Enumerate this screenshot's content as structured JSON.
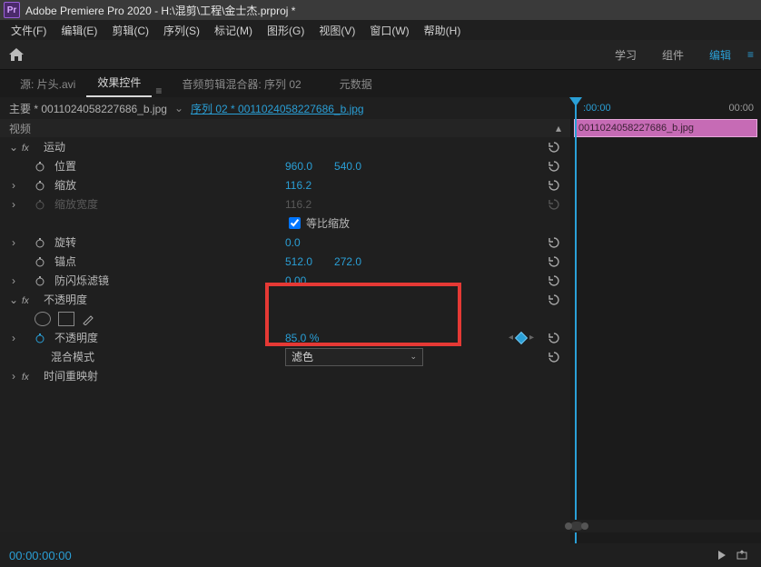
{
  "title": "Adobe Premiere Pro 2020 - H:\\混剪\\工程\\金士杰.prproj *",
  "logo_text": "Pr",
  "menus": [
    "文件(F)",
    "编辑(E)",
    "剪辑(C)",
    "序列(S)",
    "标记(M)",
    "图形(G)",
    "视图(V)",
    "窗口(W)",
    "帮助(H)"
  ],
  "workspace_tabs": {
    "learn": "学习",
    "assembly": "组件",
    "editing": "编辑"
  },
  "panel_tabs": {
    "source": "源: 片头.avi",
    "effect_controls": "效果控件",
    "audio_mixer": "音频剪辑混合器: 序列 02",
    "metadata": "元数据"
  },
  "clipinfo": {
    "master_prefix": "主要 * ",
    "master_clip": "0011024058227686_b.jpg",
    "seq_label": "序列 02 * 0011024058227686_b.jpg"
  },
  "video_header": "视频",
  "motion": {
    "label": "运动",
    "position": {
      "label": "位置",
      "x": "960.0",
      "y": "540.0"
    },
    "scale": {
      "label": "缩放",
      "v": "116.2"
    },
    "scale_width": {
      "label": "缩放宽度",
      "v": "116.2"
    },
    "uniform": {
      "label": "等比缩放",
      "checked": true
    },
    "rotation": {
      "label": "旋转",
      "v": "0.0"
    },
    "anchor": {
      "label": "锚点",
      "x": "512.0",
      "y": "272.0"
    },
    "antiflicker": {
      "label": "防闪烁滤镜",
      "v": "0.00"
    }
  },
  "opacity": {
    "label": "不透明度",
    "amount": {
      "label": "不透明度",
      "v": "85.0 %"
    },
    "blend": {
      "label": "混合模式",
      "value": "滤色"
    }
  },
  "time_remap": {
    "label": "时间重映射"
  },
  "timeline": {
    "start": "00:00",
    "end": "00:00",
    "clip_name": "0011024058227686_b.jpg",
    "playhead": ":00:00"
  },
  "playbar": {
    "tc": "00:00:00:00"
  }
}
